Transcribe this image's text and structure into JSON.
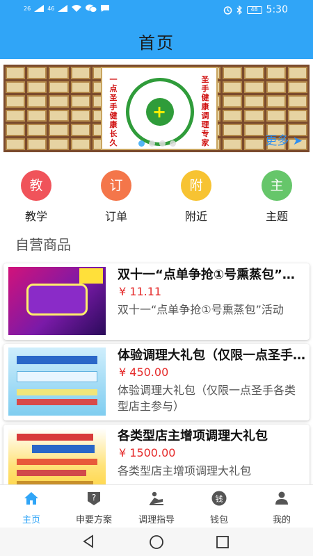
{
  "status_bar": {
    "network_left": "26",
    "network_right": "46",
    "battery": "48",
    "time": "5:30"
  },
  "header": {
    "title": "首页"
  },
  "banner": {
    "left_vertical_text": "一点圣手健康长久",
    "right_vertical_text": "圣手健康调理专家",
    "more_label": "更多"
  },
  "quick_menu": [
    {
      "icon_char": "教",
      "label": "教学",
      "color": "#f0535a"
    },
    {
      "icon_char": "订",
      "label": "订单",
      "color": "#f4764a"
    },
    {
      "icon_char": "附",
      "label": "附近",
      "color": "#f7c332"
    },
    {
      "icon_char": "主",
      "label": "主题",
      "color": "#66c66a"
    }
  ],
  "section_title": "自营商品",
  "products": [
    {
      "name": "双十一“点单争抢①号熏蒸包”活动",
      "price": "¥ 11.11",
      "desc": "双十一“点单争抢①号熏蒸包”活动"
    },
    {
      "name": "体验调理大礼包（仅限一点圣手各类型店主参与）",
      "price": "¥ 450.00",
      "desc": "体验调理大礼包（仅限一点圣手各类型店主参与）"
    },
    {
      "name": "各类型店主增项调理大礼包",
      "price": "¥ 1500.00",
      "desc": "各类型店主增项调理大礼包"
    }
  ],
  "tabbar": [
    {
      "label": "主页",
      "icon": "home-icon",
      "active": true
    },
    {
      "label": "申要方案",
      "icon": "question-shield-icon",
      "active": false
    },
    {
      "label": "调理指导",
      "icon": "massage-icon",
      "active": false
    },
    {
      "label": "钱包",
      "icon": "wallet-icon",
      "active": false
    },
    {
      "label": "我的",
      "icon": "person-icon",
      "active": false
    }
  ],
  "colors": {
    "accent": "#30a5f7",
    "price": "#e52b2b"
  }
}
